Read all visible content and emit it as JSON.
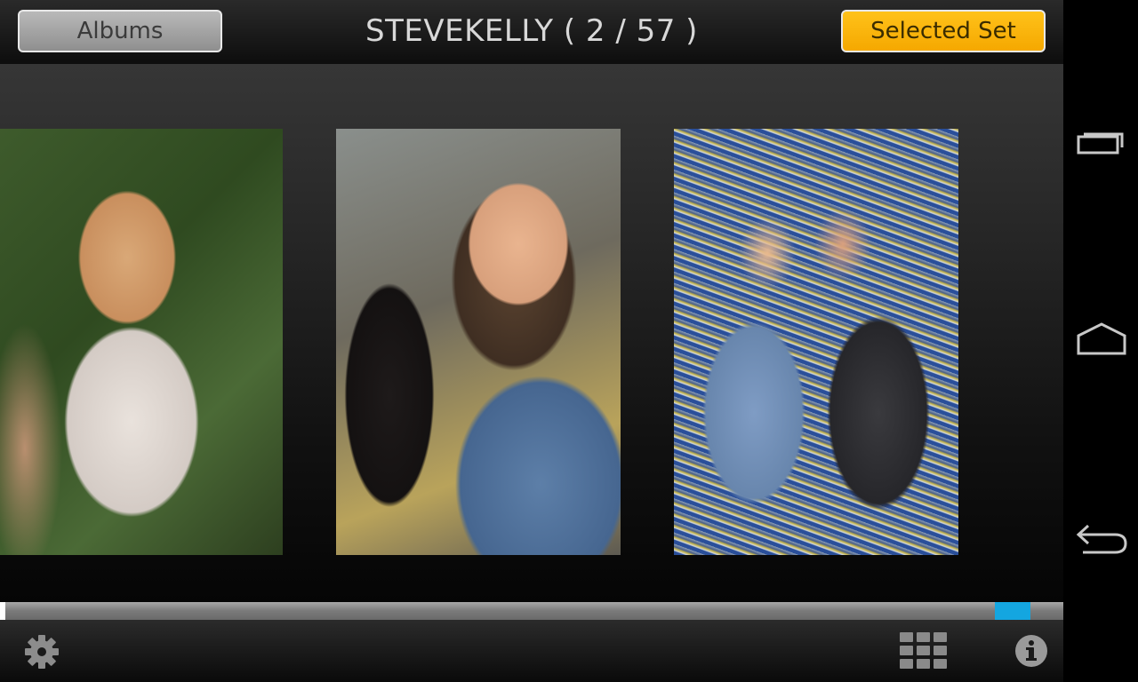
{
  "topbar": {
    "albums_label": "Albums",
    "title": "STEVEKELLY ( 2 / 57 )",
    "selected_set_label": "Selected Set"
  },
  "gallery": {
    "photos": [
      {
        "description": "child-portrait"
      },
      {
        "description": "two-friends-laughing"
      },
      {
        "description": "two-girls-by-bicycles"
      }
    ]
  },
  "progress": {
    "position_fraction": 0.97
  },
  "bottombar": {
    "icons": [
      "settings-icon",
      "grid-icon",
      "info-icon"
    ]
  },
  "navbar": {
    "icons": [
      "recent-apps-icon",
      "home-icon",
      "back-icon"
    ]
  },
  "colors": {
    "accent_yellow": "#f5a800",
    "progress_blue": "#14a6e0"
  }
}
